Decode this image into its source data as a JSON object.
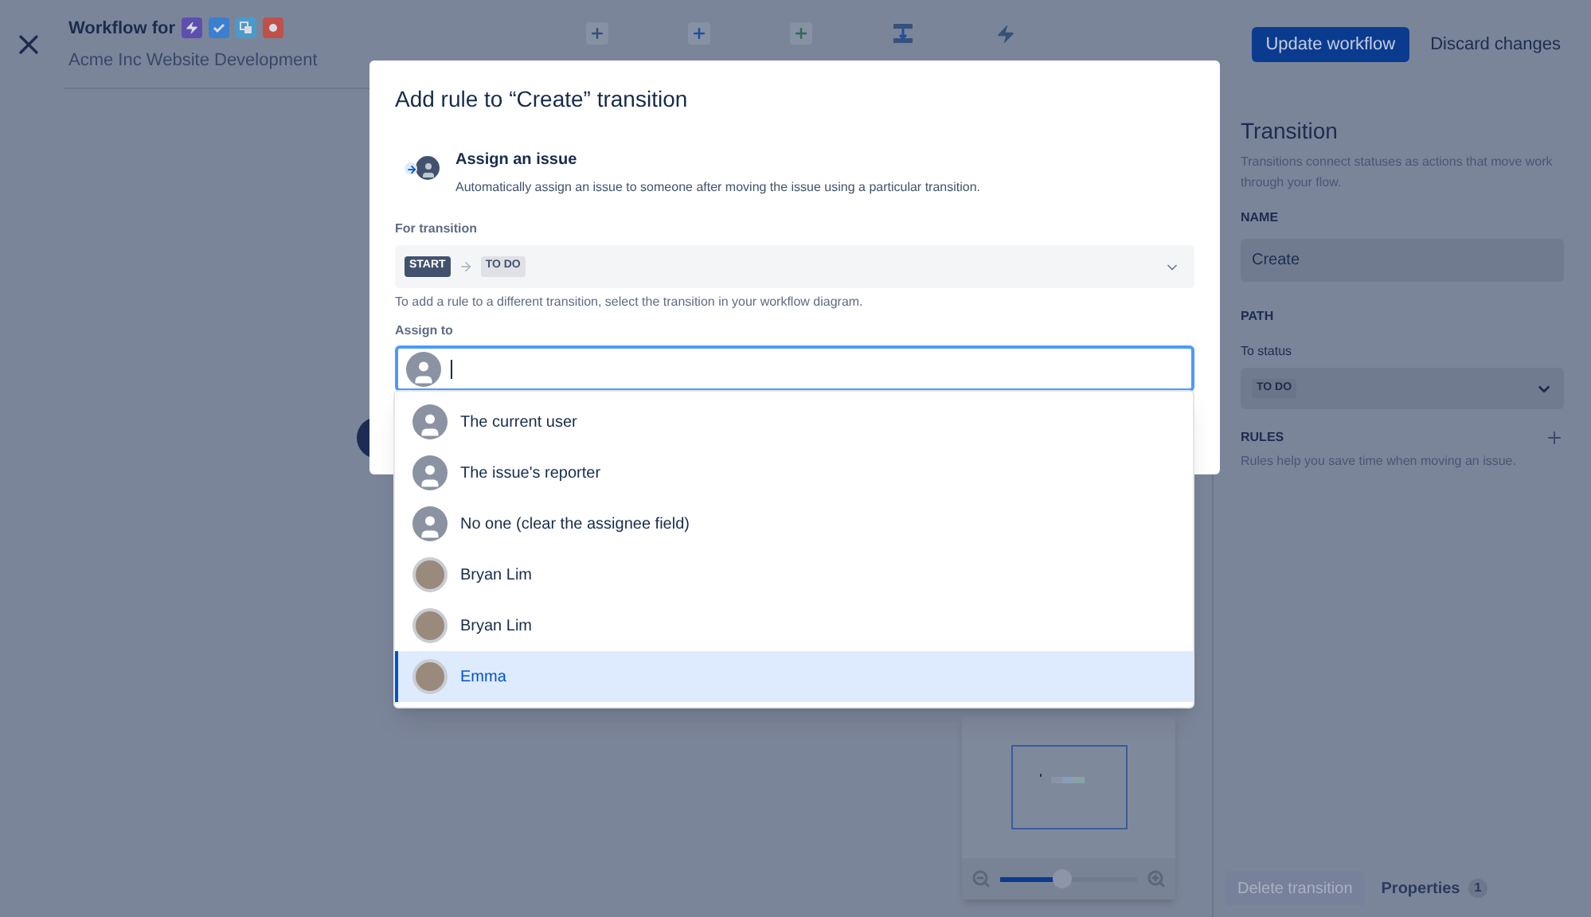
{
  "header": {
    "title": "Workflow for",
    "issue_types": [
      {
        "kind": "story",
        "color": "#5e4fae"
      },
      {
        "kind": "task",
        "color": "#3b7fd0"
      },
      {
        "kind": "subtask",
        "color": "#4a9acb"
      },
      {
        "kind": "bug",
        "color": "#c0504a"
      }
    ],
    "subtitle": "Acme Inc Website Development",
    "toolbar": [
      {
        "kind": "plus",
        "color": "#36527a"
      },
      {
        "kind": "plus",
        "color": "#1f4fa0"
      },
      {
        "kind": "plus",
        "color": "#2f6b52"
      },
      {
        "kind": "transition",
        "color": "#36527a"
      },
      {
        "kind": "rule",
        "color": "#36527a"
      }
    ],
    "buttons": [
      {
        "label": "Update workflow",
        "kind": "primary"
      },
      {
        "label": "Discard changes",
        "kind": "subtle"
      }
    ]
  },
  "modal": {
    "title": "Add rule to “Create” transition",
    "rule": {
      "title": "Assign an issue",
      "description": "Automatically assign an issue to someone after moving the issue using a particular transition."
    },
    "for_transition": {
      "label": "For transition",
      "from": "START",
      "to": "TO DO",
      "hint": "To add a rule to a different transition, select the transition in your workflow diagram."
    },
    "assign_to": {
      "label": "Assign to"
    }
  },
  "options": [
    {
      "label": "The current user",
      "kind": "generic",
      "selected": false
    },
    {
      "label": "The issue's reporter",
      "kind": "generic",
      "selected": false
    },
    {
      "label": "No one (clear the assignee field)",
      "kind": "generic",
      "selected": false
    },
    {
      "label": "Bryan Lim",
      "kind": "photo",
      "selected": false
    },
    {
      "label": "Bryan Lim",
      "kind": "photo",
      "selected": false
    },
    {
      "label": "Emma",
      "kind": "photo",
      "selected": true
    }
  ],
  "panel": {
    "title": "Transition",
    "description": "Transitions connect statuses as actions that move work through your flow.",
    "name_label": "NAME",
    "name_value": "Create",
    "path_label": "PATH",
    "to_status_label": "To status",
    "to_status_value": "TO DO",
    "rules_label": "RULES",
    "rules_hint": "Rules help you save time when moving an issue."
  },
  "footer": {
    "delete": {
      "label": "Delete transition",
      "disabled": true
    },
    "properties": {
      "label": "Properties",
      "count": "1"
    }
  },
  "minimap": {
    "zoom": {
      "level": 0.45
    }
  }
}
